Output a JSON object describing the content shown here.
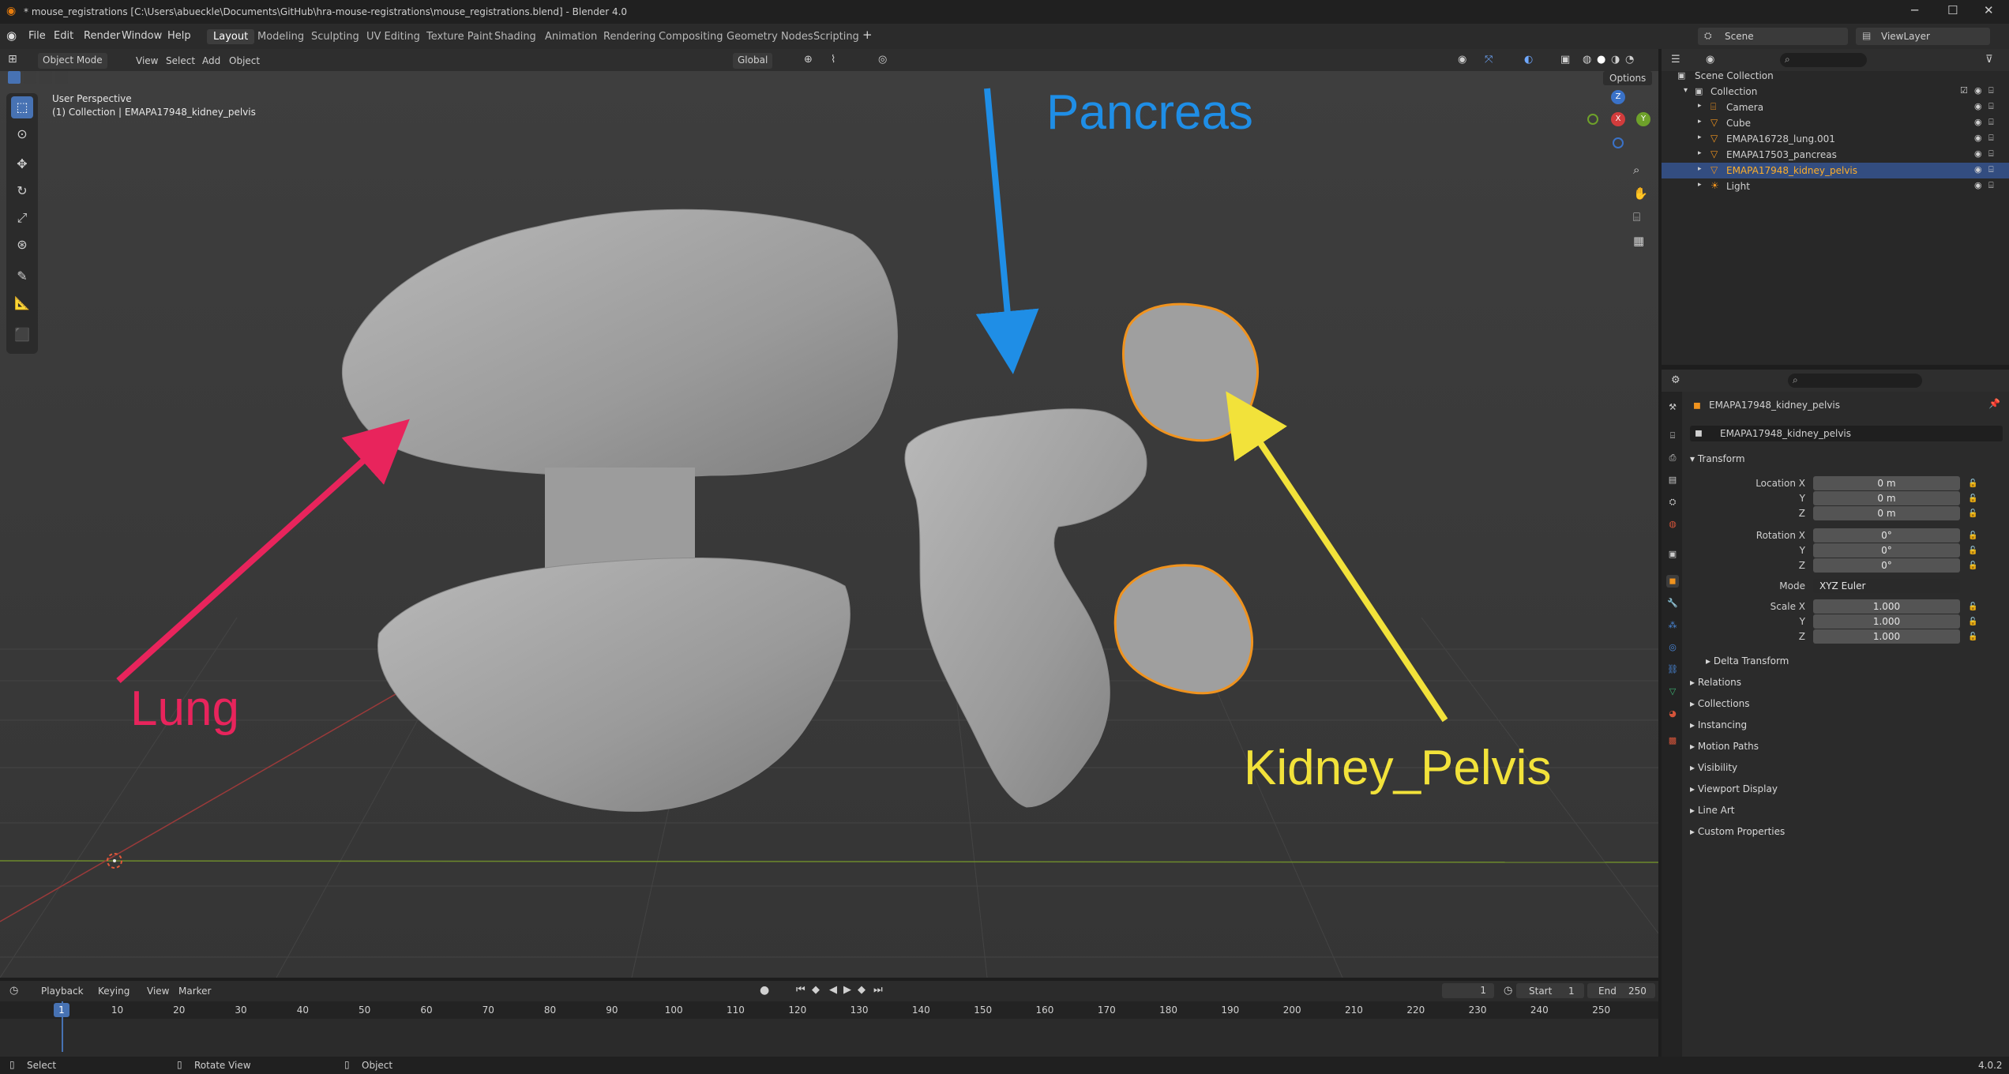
{
  "window": {
    "title": "* mouse_registrations [C:\\Users\\abueckle\\Documents\\GitHub\\hra-mouse-registrations\\mouse_registrations.blend] - Blender 4.0",
    "minimize": "─",
    "maximize": "☐",
    "close": "✕"
  },
  "menu": {
    "items": [
      "File",
      "Edit",
      "Render",
      "Window",
      "Help"
    ],
    "workspaces": [
      "Layout",
      "Modeling",
      "Sculpting",
      "UV Editing",
      "Texture Paint",
      "Shading",
      "Animation",
      "Rendering",
      "Compositing",
      "Geometry Nodes",
      "Scripting"
    ],
    "add_tab": "+",
    "scene_label": "Scene",
    "viewlayer_label": "ViewLayer"
  },
  "viewport": {
    "mode": "Object Mode",
    "menus": [
      "View",
      "Select",
      "Add",
      "Object"
    ],
    "transform_orientation": "Global",
    "options": "Options",
    "perspective": "User Perspective",
    "context": "(1) Collection | EMAPA17948_kidney_pelvis",
    "gizmo": {
      "z": "Z",
      "x": "X",
      "y": "Y"
    },
    "annotations": {
      "lung": "Lung",
      "pancreas": "Pancreas",
      "kidney": "Kidney_Pelvis"
    },
    "colors": {
      "lung": "#e8245c",
      "pancreas": "#1f8ee6",
      "kidney": "#f2e23a",
      "selection": "#f0931e"
    }
  },
  "timeline": {
    "menus": [
      "Playback",
      "Keying",
      "View",
      "Marker"
    ],
    "current_frame": "1",
    "start_label": "Start",
    "start": "1",
    "end_label": "End",
    "end": "250",
    "ticks": [
      "1",
      "10",
      "20",
      "30",
      "40",
      "50",
      "60",
      "70",
      "80",
      "90",
      "100",
      "110",
      "120",
      "130",
      "140",
      "150",
      "160",
      "170",
      "180",
      "190",
      "200",
      "210",
      "220",
      "230",
      "240",
      "250"
    ]
  },
  "status": {
    "select": "Select",
    "rotate": "Rotate View",
    "object": "Object",
    "version": "4.0.2"
  },
  "outliner": {
    "scene_collection": "Scene Collection",
    "collection": "Collection",
    "items": [
      "Camera",
      "Cube",
      "EMAPA16728_lung.001",
      "EMAPA17503_pancreas",
      "EMAPA17948_kidney_pelvis",
      "Light"
    ]
  },
  "properties": {
    "object_name": "EMAPA17948_kidney_pelvis",
    "data_name": "EMAPA17948_kidney_pelvis",
    "transform": "Transform",
    "location_x_label": "Location X",
    "y_label": "Y",
    "z_label": "Z",
    "rotation_x_label": "Rotation X",
    "scale_x_label": "Scale X",
    "mode_label": "Mode",
    "location": [
      "0 m",
      "0 m",
      "0 m"
    ],
    "rotation": [
      "0°",
      "0°",
      "0°"
    ],
    "mode": "XYZ Euler",
    "scale": [
      "1.000",
      "1.000",
      "1.000"
    ],
    "delta": "Delta Transform",
    "sections": [
      "Relations",
      "Collections",
      "Instancing",
      "Motion Paths",
      "Visibility",
      "Viewport Display",
      "Line Art",
      "Custom Properties"
    ]
  }
}
